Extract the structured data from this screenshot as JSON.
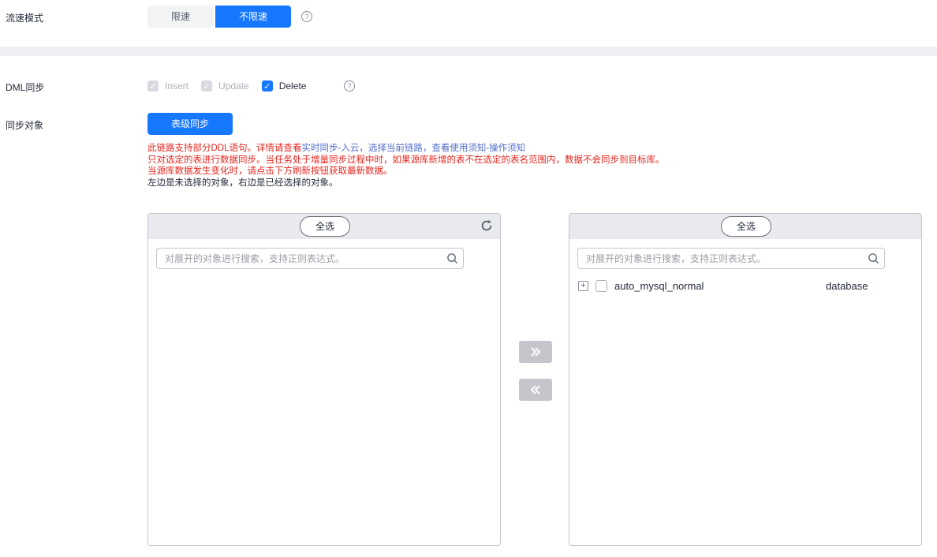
{
  "flow_mode": {
    "label": "流速模式",
    "options": [
      "限速",
      "不限速"
    ],
    "selected": "不限速",
    "help": "?"
  },
  "dml": {
    "label": "DML同步",
    "options": [
      {
        "label": "Insert",
        "checked": true,
        "disabled": true
      },
      {
        "label": "Update",
        "checked": true,
        "disabled": true
      },
      {
        "label": "Delete",
        "checked": true,
        "disabled": false
      }
    ],
    "help": "?"
  },
  "sync_objects": {
    "label": "同步对象",
    "button_label": "表级同步",
    "notes": {
      "line1_red": "此链路支持部分DDL语句。详情请查看",
      "line1_link": "实时同步-入云，选择当前链路，查看使用须知-操作须知",
      "line2_red": "只对选定的表进行数据同步。当任务处于增量同步过程中时，如果源库新增的表不在选定的表名范围内，数据不会同步到目标库。",
      "line3_red": "当源库数据发生变化时，请点击下方刷新按钮获取最新数据。",
      "line4": "左边是未选择的对象，右边是已经选择的对象。"
    }
  },
  "left_panel": {
    "select_all_label": "全选",
    "search_placeholder": "对展开的对象进行搜索，支持正则表达式。"
  },
  "right_panel": {
    "select_all_label": "全选",
    "search_placeholder": "对展开的对象进行搜索，支持正则表达式。",
    "items": [
      {
        "name": "auto_mysql_normal",
        "type": "database",
        "checked": false
      }
    ]
  },
  "colors": {
    "primary": "#1677ff",
    "warning_text": "#e5261f",
    "link_text": "#526ecc"
  }
}
